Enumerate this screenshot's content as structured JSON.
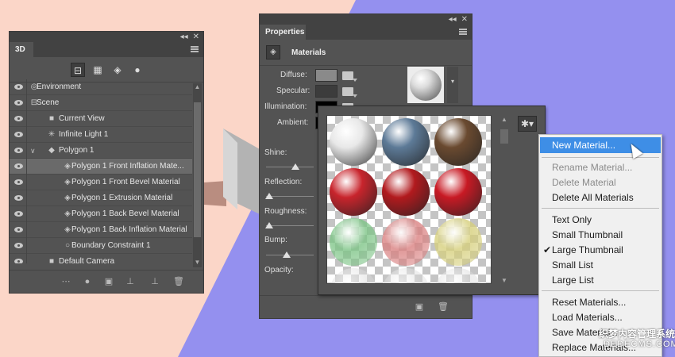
{
  "layers_panel": {
    "title": "3D",
    "items": [
      {
        "label": "Environment",
        "icon": "environment-icon",
        "indent": 0
      },
      {
        "label": "Scene",
        "icon": "scene-icon",
        "indent": 0
      },
      {
        "label": "Current View",
        "icon": "camera-icon",
        "indent": 1
      },
      {
        "label": "Infinite Light 1",
        "icon": "light-icon",
        "indent": 1
      },
      {
        "label": "Polygon 1",
        "icon": "mesh-icon",
        "indent": 1,
        "expanded": true
      },
      {
        "label": "Polygon 1 Front Inflation Mate...",
        "icon": "material-icon",
        "indent": 2,
        "selected": true
      },
      {
        "label": "Polygon 1 Front Bevel Material",
        "icon": "material-icon",
        "indent": 2
      },
      {
        "label": "Polygon 1 Extrusion Material",
        "icon": "material-icon",
        "indent": 2
      },
      {
        "label": "Polygon 1 Back Bevel Material",
        "icon": "material-icon",
        "indent": 2
      },
      {
        "label": "Polygon 1 Back Inflation Material",
        "icon": "material-icon",
        "indent": 2
      },
      {
        "label": "Boundary Constraint 1",
        "icon": "constraint-icon",
        "indent": 2
      },
      {
        "label": "Default Camera",
        "icon": "camera-icon",
        "indent": 1
      }
    ]
  },
  "properties_panel": {
    "title": "Properties",
    "section": "Materials",
    "labels": {
      "diffuse": "Diffuse:",
      "specular": "Specular:",
      "illumination": "Illumination:",
      "ambient": "Ambient:",
      "shine": "Shine:",
      "reflection": "Reflection:",
      "roughness": "Roughness:",
      "bump": "Bump:",
      "opacity": "Opacity:"
    },
    "colors": {
      "diffuse": "#8a8a8a",
      "specular": "#3c3c3c",
      "illumination": "#000000",
      "ambient": "#000000"
    }
  },
  "material_picker": {
    "materials": [
      {
        "name": "white-glossy",
        "color": "#e8e8e8"
      },
      {
        "name": "blue-metal",
        "color": "#5d7a97"
      },
      {
        "name": "brown-wood",
        "color": "#6a4a30"
      },
      {
        "name": "red-fabric",
        "color": "#c8242c"
      },
      {
        "name": "red-fabric-dark",
        "color": "#b21a1e"
      },
      {
        "name": "red-stitched",
        "color": "#c81a24"
      },
      {
        "name": "green-glass",
        "color": "#7dc486"
      },
      {
        "name": "pink-glass",
        "color": "#d98080"
      },
      {
        "name": "yellow-glass",
        "color": "#d6cf7c"
      }
    ]
  },
  "context_menu": {
    "items": [
      {
        "label": "New Material...",
        "highlighted": true
      },
      {
        "label": "Rename Material...",
        "disabled": true
      },
      {
        "label": "Delete Material",
        "disabled": true
      },
      {
        "label": "Delete All Materials"
      },
      {
        "label": "Text Only"
      },
      {
        "label": "Small Thumbnail"
      },
      {
        "label": "Large Thumbnail",
        "checked": true
      },
      {
        "label": "Small List"
      },
      {
        "label": "Large List"
      },
      {
        "label": "Reset Materials..."
      },
      {
        "label": "Load Materials..."
      },
      {
        "label": "Save Materials..."
      },
      {
        "label": "Replace Materials..."
      }
    ]
  },
  "watermark": {
    "line1": "织梦内容管理系统",
    "line2": "DEDECMS.COM"
  },
  "theme": {
    "panel_bg": "#535353",
    "highlight": "#3e8ee6",
    "bg_peach": "#fbd6c8",
    "bg_purple": "#9490ef"
  }
}
